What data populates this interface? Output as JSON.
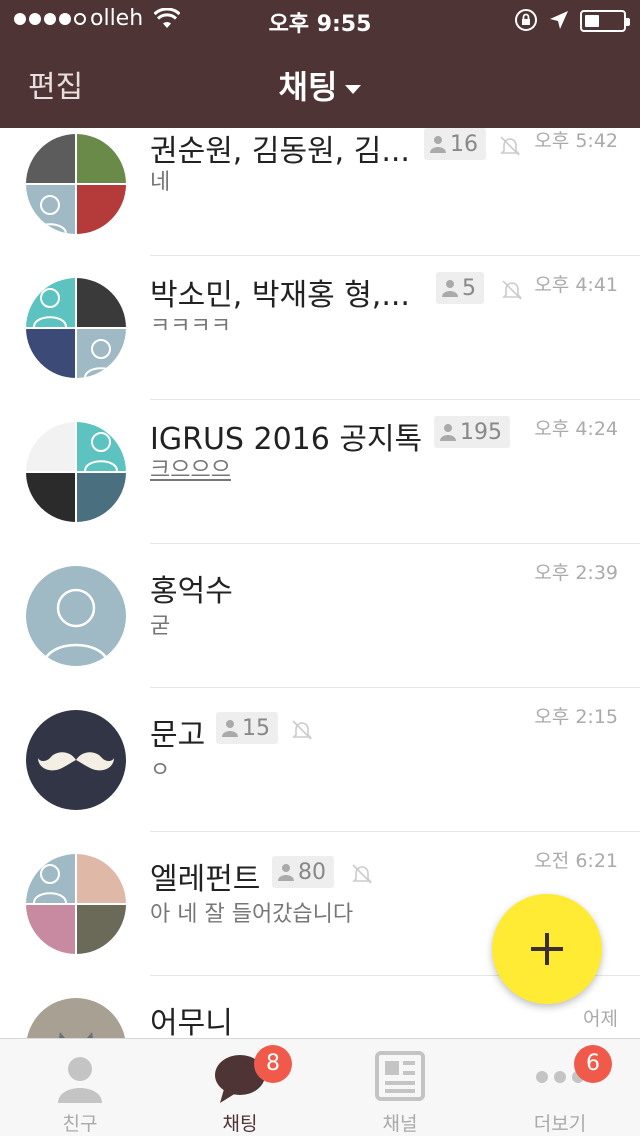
{
  "status_bar": {
    "carrier": "olleh",
    "time": "오후 9:55"
  },
  "header": {
    "edit_label": "편집",
    "title": "채팅"
  },
  "chats": [
    {
      "name": "권순원, 김동원, 김...",
      "members": "16",
      "muted": true,
      "time": "오후 5:42",
      "last_message": "네"
    },
    {
      "name": "박소민, 박재홍 형,...",
      "members": "5",
      "muted": true,
      "time": "오후 4:41",
      "last_message": "ㅋㅋㅋㅋ"
    },
    {
      "name": "IGRUS 2016 공지톡",
      "members": "195",
      "muted": false,
      "time": "오후 4:24",
      "last_message": "크으으으"
    },
    {
      "name": "홍억수",
      "members": "",
      "muted": false,
      "time": "오후 2:39",
      "last_message": "굳"
    },
    {
      "name": "문고",
      "members": "15",
      "muted": true,
      "time": "오후 2:15",
      "last_message": "ㅇ"
    },
    {
      "name": "엘레펀트",
      "members": "80",
      "muted": true,
      "time": "오전 6:21",
      "last_message": "아 네 잘 들어갔습니다"
    },
    {
      "name": "어무니",
      "members": "",
      "muted": false,
      "time": "어제",
      "last_message": ""
    }
  ],
  "tabs": [
    {
      "label": "친구",
      "icon": "person-icon",
      "badge": ""
    },
    {
      "label": "채팅",
      "icon": "chat-bubble-icon",
      "badge": "8"
    },
    {
      "label": "채널",
      "icon": "channel-news-icon",
      "badge": ""
    },
    {
      "label": "더보기",
      "icon": "more-dots-icon",
      "badge": "6"
    }
  ],
  "colors": {
    "header_bg": "#4e3434",
    "fab": "#ffeb33",
    "badge": "#f05a4a",
    "avatar_default": "#9fbac4"
  }
}
